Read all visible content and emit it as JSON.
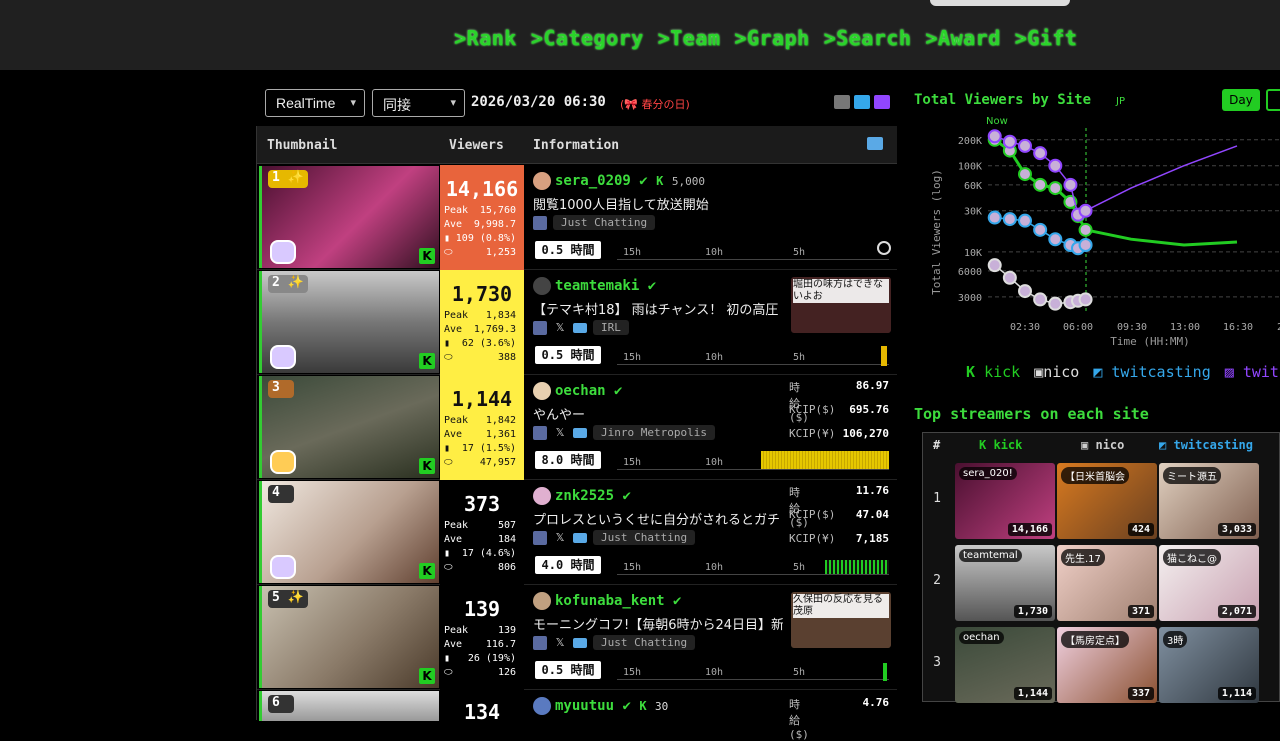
{
  "nav": [
    ">Rank",
    ">Category",
    ">Team",
    ">Graph",
    ">Search",
    ">Award",
    ">Gift"
  ],
  "controls": {
    "mode_select": "RealTime",
    "metric_select": "同接",
    "datetime": "2026/03/20 06:30",
    "holiday": "春分の日"
  },
  "table": {
    "headers": {
      "thumbnail": "Thumbnail",
      "viewers": "Viewers",
      "information": "Information"
    },
    "stat_labels": {
      "peak": "Peak",
      "ave": "Ave"
    },
    "timeline_labels": [
      "15h",
      "10h",
      "5h"
    ],
    "rows": [
      {
        "rank": "1",
        "viewers": "14,166",
        "peak": "15,760",
        "ave": "9,998.7",
        "chat": "109 (0.8%)",
        "other": "1,253",
        "name": "sera_0209",
        "kick_followers": "5,000",
        "title": "閲覧1000人目指して放送開始",
        "category": "Just Chatting",
        "hours": "0.5 時間",
        "bg": "#e8643c",
        "color": "#fff"
      },
      {
        "rank": "2",
        "viewers": "1,730",
        "peak": "1,834",
        "ave": "1,769.3",
        "chat": "62 (3.6%)",
        "other": "388",
        "name": "teamtemaki",
        "title": "【テマキ村18】 雨はチャンス！ 初の高圧",
        "category": "IRL",
        "hours": "0.5 時間",
        "preview": "堀田の味方はできないよお",
        "bg": "#ffee44",
        "color": "#111"
      },
      {
        "rank": "3",
        "viewers": "1,144",
        "peak": "1,842",
        "ave": "1,361",
        "chat": "17 (1.5%)",
        "other": "47,957",
        "name": "oechan",
        "title": "やんやー",
        "category": "Jinro Metropolis",
        "hours": "8.0 時間",
        "bg": "#ffee44",
        "color": "#111",
        "kc": [
          [
            "時給($)",
            "86.97"
          ],
          [
            "KCIP($)",
            "695.76"
          ],
          [
            "KCIP(¥)",
            "106,270"
          ]
        ]
      },
      {
        "rank": "4",
        "viewers": "373",
        "peak": "507",
        "ave": "184",
        "chat": "17 (4.6%)",
        "other": "806",
        "name": "znk2525",
        "title": "プロレスというくせに自分がされるとガチ",
        "category": "Just Chatting",
        "hours": "4.0 時間",
        "bg": "#000",
        "color": "#fff",
        "kc": [
          [
            "時給($)",
            "11.76"
          ],
          [
            "KCIP($)",
            "47.04"
          ],
          [
            "KCIP(¥)",
            "7,185"
          ]
        ]
      },
      {
        "rank": "5",
        "viewers": "139",
        "peak": "139",
        "ave": "116.7",
        "chat": "26 (19%)",
        "other": "126",
        "name": "kofunaba_kent",
        "title": "モーニングコフ!【毎朝6時から24日目】新",
        "category": "Just Chatting",
        "hours": "0.5 時間",
        "preview": "久保田の反応を見る茂原",
        "bg": "#000",
        "color": "#fff"
      },
      {
        "rank": "6",
        "viewers": "134",
        "name": "myuutuu",
        "kick_followers": "30",
        "bg": "#000",
        "color": "#fff",
        "kc": [
          [
            "時給($)",
            "4.76"
          ]
        ]
      }
    ]
  },
  "chart": {
    "title": "Total Viewers by Site",
    "jp": "JP",
    "range_button": "Day",
    "now_label": "Now",
    "ylabel": "Total Viewers (log)",
    "xlabel": "Time (HH:MM)",
    "yticks": [
      "200K",
      "100K",
      "60K",
      "30K",
      "10K",
      "6000",
      "3000"
    ],
    "xticks": [
      "02:30",
      "06:00",
      "09:30",
      "13:00",
      "16:30",
      "2"
    ]
  },
  "chart_data": {
    "type": "line",
    "title": "Total Viewers by Site",
    "xlabel": "Time (HH:MM)",
    "ylabel": "Total Viewers (log)",
    "yscale": "log",
    "x": [
      "00:30",
      "01:30",
      "02:30",
      "03:30",
      "04:30",
      "05:30",
      "06:00",
      "06:30",
      "09:30",
      "13:00",
      "16:30"
    ],
    "series": [
      {
        "name": "kick",
        "values": [
          200000,
          150000,
          80000,
          60000,
          55000,
          38000,
          26000,
          18000,
          14000,
          12000,
          13000
        ]
      },
      {
        "name": "nico",
        "values": [
          7000,
          5000,
          3500,
          2800,
          2500,
          2600,
          2700,
          2800,
          null,
          null,
          null
        ]
      },
      {
        "name": "twitcasting",
        "values": [
          25000,
          24000,
          23000,
          18000,
          14000,
          12000,
          11000,
          12000,
          null,
          null,
          null
        ]
      },
      {
        "name": "twitch",
        "values": [
          220000,
          190000,
          170000,
          140000,
          100000,
          60000,
          27000,
          30000,
          55000,
          100000,
          170000
        ]
      }
    ]
  },
  "site_legend": [
    "kick",
    "nico",
    "twitcasting",
    "twit"
  ],
  "top_streamers": {
    "title": "Top streamers on each site",
    "headers": [
      "#",
      "kick",
      "nico",
      "twitcasting"
    ],
    "rows": [
      {
        "rank": "1",
        "cells": [
          {
            "name": "sera_020!",
            "viewers": "14,166"
          },
          {
            "name": "【日米首脳会",
            "viewers": "424"
          },
          {
            "name": "ミート源五",
            "viewers": "3,033"
          }
        ]
      },
      {
        "rank": "2",
        "cells": [
          {
            "name": "teamtemal",
            "viewers": "1,730"
          },
          {
            "name": "先生.17",
            "viewers": "371"
          },
          {
            "name": "猫こねこ@",
            "viewers": "2,071"
          }
        ]
      },
      {
        "rank": "3",
        "cells": [
          {
            "name": "oechan",
            "viewers": "1,144"
          },
          {
            "name": "【馬房定点】",
            "viewers": "337"
          },
          {
            "name": "3時",
            "viewers": "1,114"
          }
        ]
      }
    ]
  },
  "colors": {
    "accent": "#3ddc3d",
    "kick": "#22cc22",
    "twitch": "#9146ff",
    "twitcasting": "#35a7ea",
    "nico": "#dddddd",
    "top_viewers": "#e8643c",
    "high_viewers": "#ffee44"
  }
}
